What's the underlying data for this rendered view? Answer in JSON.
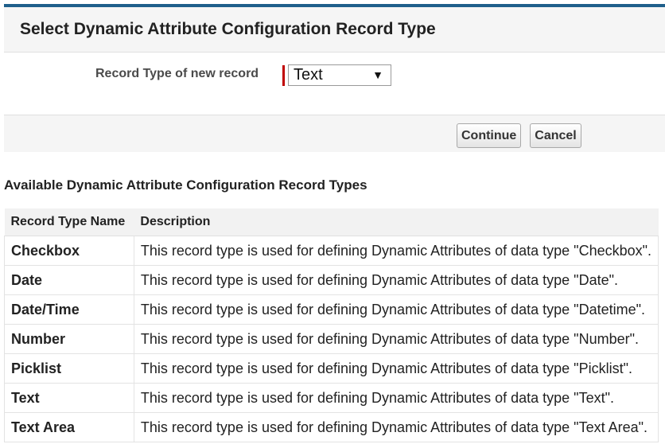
{
  "header": {
    "title": "Select Dynamic Attribute Configuration Record Type"
  },
  "form": {
    "label": "Record Type of new record",
    "selected_value": "Text",
    "required_color": "#c00000"
  },
  "buttons": {
    "continue_label": "Continue",
    "cancel_label": "Cancel"
  },
  "section": {
    "title": "Available Dynamic Attribute Configuration Record Types"
  },
  "table": {
    "columns": [
      "Record Type Name",
      "Description"
    ],
    "rows": [
      {
        "name": "Checkbox",
        "description": "This record type is used for defining Dynamic Attributes of data type \"Checkbox\"."
      },
      {
        "name": "Date",
        "description": "This record type is used for defining Dynamic Attributes of data type \"Date\"."
      },
      {
        "name": "Date/Time",
        "description": "This record type is used for defining Dynamic Attributes of data type \"Datetime\"."
      },
      {
        "name": "Number",
        "description": "This record type is used for defining Dynamic Attributes of data type \"Number\"."
      },
      {
        "name": "Picklist",
        "description": "This record type is used for defining Dynamic Attributes of data type \"Picklist\"."
      },
      {
        "name": "Text",
        "description": "This record type is used for defining Dynamic Attributes of data type \"Text\"."
      },
      {
        "name": "Text Area",
        "description": "This record type is used for defining Dynamic Attributes of data type \"Text Area\"."
      }
    ]
  },
  "colors": {
    "accent_border": "#1f5f8b",
    "panel_background": "#f5f5f5"
  }
}
